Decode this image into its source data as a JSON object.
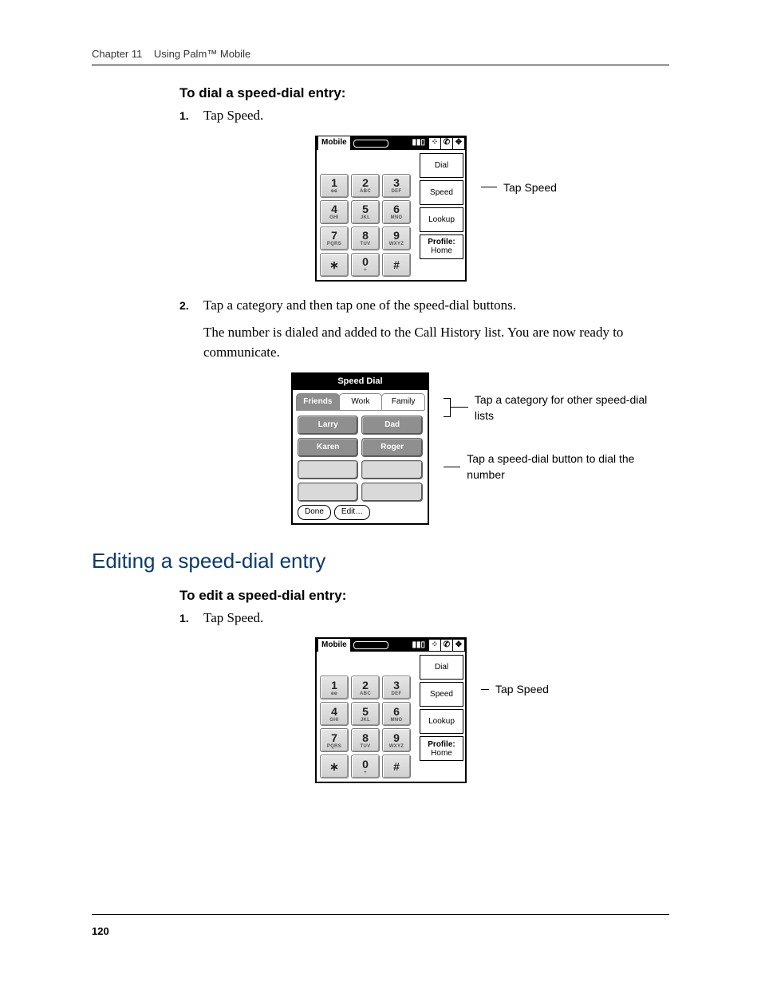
{
  "header": {
    "chapter": "Chapter 11",
    "title": "Using Palm™ Mobile"
  },
  "page_number": "120",
  "proc1": {
    "heading": "To dial a speed-dial entry:",
    "step1": "Tap Speed.",
    "step2": "Tap a category and then tap one of the speed-dial buttons.",
    "step2_note": "The number is dialed and added to the Call History list. You are now ready to communicate."
  },
  "section2": {
    "title": "Editing a speed-dial entry"
  },
  "proc2": {
    "heading": "To edit a speed-dial entry:",
    "step1": "Tap Speed."
  },
  "device": {
    "title": "Mobile",
    "side": {
      "dial": "Dial",
      "speed": "Speed",
      "lookup": "Lookup",
      "profile_label": "Profile:",
      "profile_value": "Home"
    },
    "keys": {
      "k1": "1",
      "k1s": "",
      "k2": "2",
      "k2s": "ABC",
      "k3": "3",
      "k3s": "DEF",
      "k4": "4",
      "k4s": "GHI",
      "k5": "5",
      "k5s": "JKL",
      "k6": "6",
      "k6s": "MNO",
      "k7": "7",
      "k7s": "PQRS",
      "k8": "8",
      "k8s": "TUV",
      "k9": "9",
      "k9s": "WXYZ",
      "kstar": "∗",
      "k0": "0",
      "k0s": "+",
      "khash": "#"
    }
  },
  "speed_dial": {
    "title": "Speed Dial",
    "tabs": {
      "friends": "Friends",
      "work": "Work",
      "family": "Family"
    },
    "entries": {
      "a": "Larry",
      "b": "Dad",
      "c": "Karen",
      "d": "Roger"
    },
    "done": "Done",
    "edit": "Edit…"
  },
  "callouts": {
    "tap_speed": "Tap Speed",
    "tap_category": "Tap a category for other speed-dial lists",
    "tap_button": "Tap a speed-dial button to dial the number"
  }
}
